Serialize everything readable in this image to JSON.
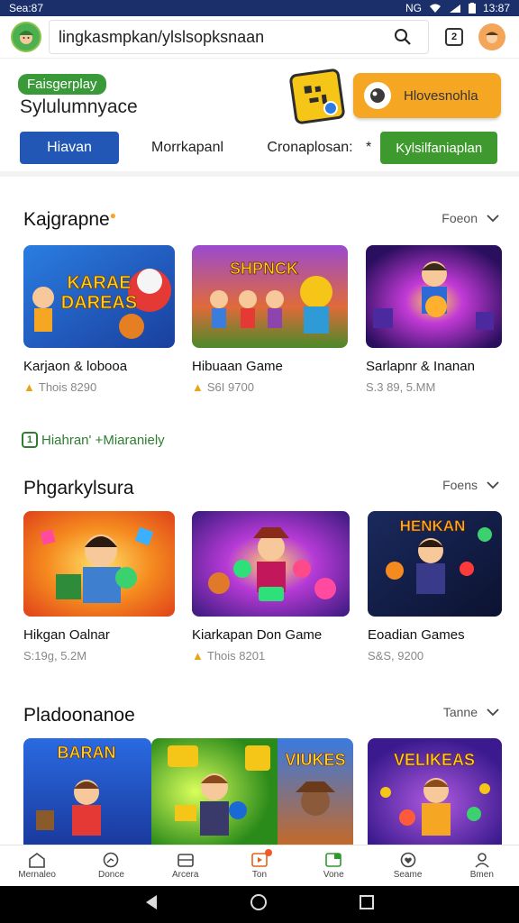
{
  "status": {
    "left": "Sea:87",
    "right": "13:87",
    "signal_text": "NG"
  },
  "browser": {
    "url": "lingkasmpkan/ylslsopksnaan",
    "tab_count": "2"
  },
  "header": {
    "badge": "Faisgerplay",
    "brand": "Sylulumnyace",
    "cta_label": "Hlovesnohla",
    "tabs": [
      {
        "label": "Hiavan",
        "active": true
      },
      {
        "label": "Morrkapanl",
        "active": false
      },
      {
        "label": "Cronaplosan:",
        "active": false
      },
      {
        "label": "*",
        "active": false
      },
      {
        "label": "Kylsilfaniaplan",
        "active": false,
        "highlight": true
      }
    ]
  },
  "sections": [
    {
      "title": "Kajgrapne",
      "more": "Foeon",
      "items": [
        {
          "title": "Karjaon & lobooa",
          "meta": "Thois 8290",
          "coin": true,
          "thumb_text": "KARAE DAREAS"
        },
        {
          "title": "Hibuaan Game",
          "meta": "S6I 9700",
          "coin": true,
          "thumb_text": "SHPNCK"
        },
        {
          "title": "Sarlapnr & Inanan",
          "meta": "S.3 89, 5.MM",
          "coin": false,
          "thumb_text": ""
        }
      ]
    },
    {
      "title": "Phgarkylsura",
      "more": "Foens",
      "items": [
        {
          "title": "Hikgan Oalnar",
          "meta": "S:19g, 5.2M",
          "coin": false,
          "thumb_text": ""
        },
        {
          "title": "Kiarkapan Don Game",
          "meta": "Thois 8201",
          "coin": true,
          "thumb_text": ""
        },
        {
          "title": "Eoadian Games",
          "meta": "S&S, 9200",
          "coin": false,
          "thumb_text": "HENKAN"
        }
      ]
    },
    {
      "title": "Pladoonanoe",
      "more": "Tanne",
      "items": [
        {
          "title": "",
          "meta": "",
          "thumb_text": "BARAN"
        },
        {
          "title": "",
          "meta": "",
          "thumb_text": "VIUKES"
        },
        {
          "title": "",
          "meta": "",
          "thumb_text": "VELIKEAS"
        }
      ]
    }
  ],
  "promo": {
    "icon": "1",
    "text": "Hiahran' +Miaraniely"
  },
  "bottom_nav": [
    {
      "label": "Mernaleo",
      "icon": "home-icon"
    },
    {
      "label": "Donce",
      "icon": "chat-icon"
    },
    {
      "label": "Arcera",
      "icon": "folder-icon"
    },
    {
      "label": "Ton",
      "icon": "play-icon"
    },
    {
      "label": "Vone",
      "icon": "store-icon"
    },
    {
      "label": "Seame",
      "icon": "heart-icon"
    },
    {
      "label": "Bmen",
      "icon": "person-icon"
    }
  ],
  "colors": {
    "accent_blue": "#2357b5",
    "accent_green": "#3e9a2f",
    "accent_orange": "#f5a623",
    "status_bar": "#1b2f6b"
  }
}
